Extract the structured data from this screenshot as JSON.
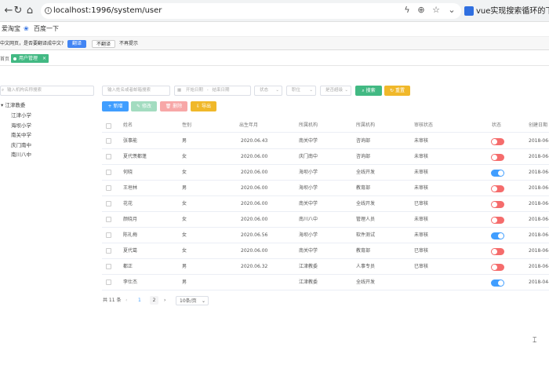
{
  "browser": {
    "url": "localhost:1996/system/user",
    "tab_title": "vue实现搜索循环的下拉框"
  },
  "bookmarks": [
    "爱淘宝",
    "百度一下"
  ],
  "translate_bar": {
    "prompt": "中文网页，是否要翻译成中文?",
    "translate": "翻译",
    "dont_translate": "不翻译",
    "never": "不再提示"
  },
  "tabs": {
    "home": "首页",
    "active": "用户管理"
  },
  "tree": {
    "search_placeholder": "输入机构名称搜索",
    "root": "江津教委",
    "children": [
      "江津小学",
      "海坝小学",
      "南关中学",
      "庆门南中",
      "南川八中"
    ]
  },
  "filters": {
    "name_placeholder": "输入姓名或者邮箱搜索",
    "start_date": "开始日期",
    "to": "-",
    "end_date": "结束日期",
    "status": "状态",
    "position": "职位",
    "gender": "是否超级",
    "search": "搜索",
    "reset": "重置"
  },
  "toolbar": {
    "add": "新增",
    "edit": "修改",
    "delete": "删除",
    "export": "导出"
  },
  "columns": [
    "姓名",
    "性别",
    "出生年月",
    "所属机构",
    "所属机构",
    "审核状态",
    "状态",
    "创建日期"
  ],
  "rows": [
    {
      "name": "张事能",
      "gender": "男",
      "birth": "2020.06.43",
      "org": "南关中学",
      "dept": "咨询部",
      "audit": "未审核",
      "on": false,
      "created": "2018-06-"
    },
    {
      "name": "夏代羡都蓬",
      "gender": "女",
      "birth": "2020.06.00",
      "org": "庆门南中",
      "dept": "咨询部",
      "audit": "未审核",
      "on": false,
      "created": "2018-06-"
    },
    {
      "name": "何晓",
      "gender": "女",
      "birth": "2020.06.00",
      "org": "海坝小学",
      "dept": "全线开发",
      "audit": "未审核",
      "on": true,
      "created": "2018-06-"
    },
    {
      "name": "王垣林",
      "gender": "男",
      "birth": "2020.06.00",
      "org": "海坝小学",
      "dept": "教育部",
      "audit": "未审核",
      "on": false,
      "created": "2018-06-"
    },
    {
      "name": "花花",
      "gender": "女",
      "birth": "2020.06.00",
      "org": "南关中学",
      "dept": "全线开发",
      "audit": "已审核",
      "on": false,
      "created": "2018-06-"
    },
    {
      "name": "颜晓月",
      "gender": "女",
      "birth": "2020.06.00",
      "org": "南川八中",
      "dept": "管理人员",
      "audit": "未审核",
      "on": false,
      "created": "2018-06-"
    },
    {
      "name": "陈礼梅",
      "gender": "女",
      "birth": "2020.06.56",
      "org": "海坝小学",
      "dept": "软件测试",
      "audit": "未审核",
      "on": true,
      "created": "2018-06-"
    },
    {
      "name": "夏代葛",
      "gender": "女",
      "birth": "2020.06.00",
      "org": "南关中学",
      "dept": "教育部",
      "audit": "已审核",
      "on": false,
      "created": "2018-06-"
    },
    {
      "name": "都正",
      "gender": "男",
      "birth": "2020.06.32",
      "org": "江津教委",
      "dept": "人事专员",
      "audit": "已审核",
      "on": false,
      "created": "2018-06-"
    },
    {
      "name": "李仕杰",
      "gender": "男",
      "birth": "",
      "org": "江津教委",
      "dept": "全线开发",
      "audit": "",
      "on": true,
      "created": "2018-04-"
    }
  ],
  "pager": {
    "total": "共 11 条",
    "pages": [
      "1",
      "2"
    ],
    "page_size": "10条/页"
  },
  "colors": {
    "primary": "#409eff",
    "success": "#42b983",
    "danger": "#f56c6c",
    "warning": "#e6a23c"
  }
}
